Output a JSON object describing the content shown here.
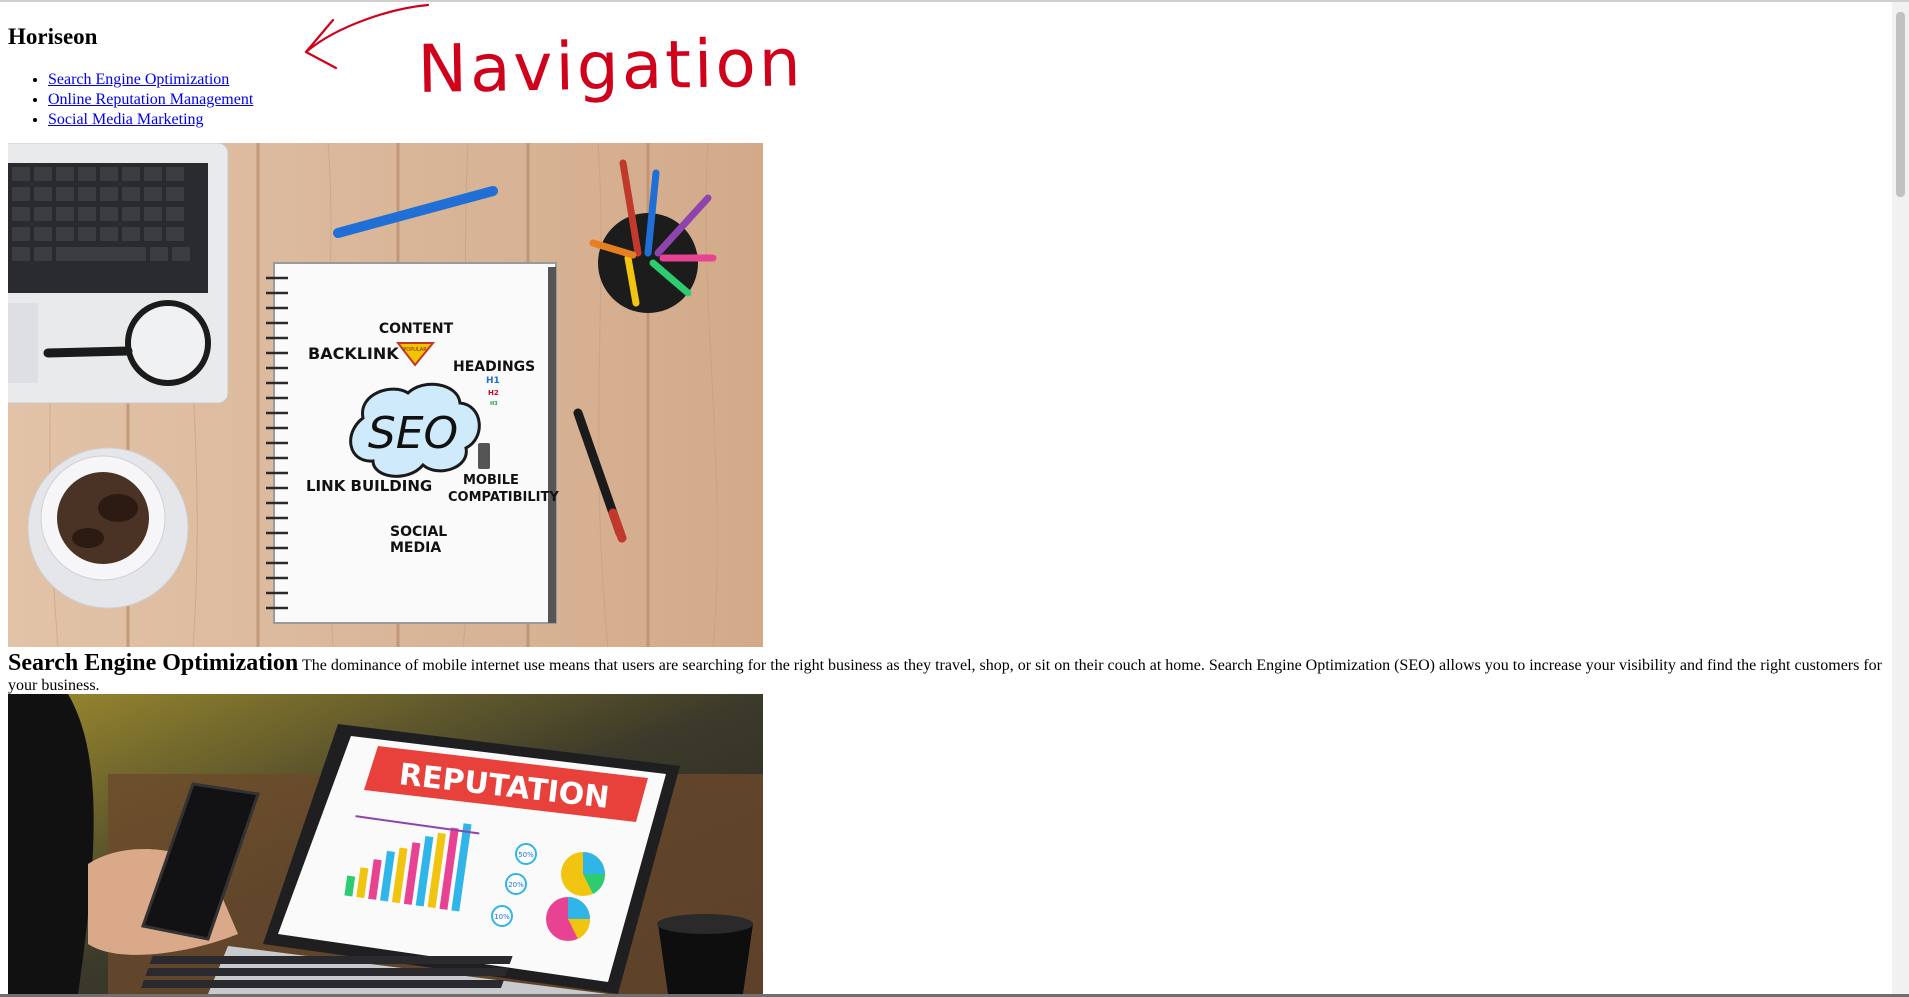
{
  "header": {
    "title": "Horiseon"
  },
  "nav": {
    "items": [
      {
        "label": "Search Engine Optimization"
      },
      {
        "label": "Online Reputation Management"
      },
      {
        "label": "Social Media Marketing"
      }
    ]
  },
  "annotation": {
    "text": "Navigation",
    "color": "#d0021b"
  },
  "hero_image": {
    "words": {
      "content": "CONTENT",
      "popular": "POPULAR",
      "backlink": "BACKLINK",
      "headings": "HEADINGS",
      "h1": "H1",
      "h2": "H2",
      "h3": "H3",
      "seo": "SEO",
      "link_building": "LINK BUILDING",
      "mobile": "MOBILE",
      "compatibility": "COMPATIBILITY",
      "social": "SOCIAL",
      "media": "MEDIA"
    }
  },
  "sections": {
    "seo": {
      "heading": "Search Engine Optimization",
      "body": "The dominance of mobile internet use means that users are searching for the right business as they travel, shop, or sit on their couch at home. Search Engine Optimization (SEO) allows you to increase your visibility and find the right customers for your business."
    }
  },
  "reputation_image": {
    "banner": "REPUTATION",
    "badges": [
      "50%",
      "20%",
      "10%"
    ]
  },
  "colors": {
    "link": "#0000ee",
    "wood": "#d9b596",
    "banner_red": "#e8413b"
  }
}
